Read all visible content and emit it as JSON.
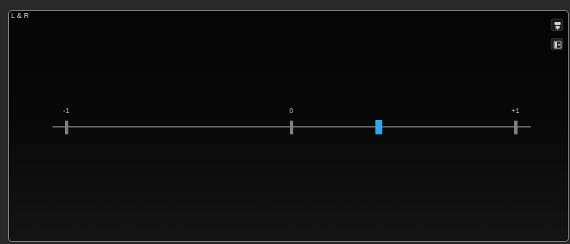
{
  "panel": {
    "title": "L & R"
  },
  "meter": {
    "scale": {
      "min_label": "-1",
      "mid_label": "0",
      "max_label": "+1"
    },
    "value": 0.39,
    "indicator_color": "#2aa8f0"
  },
  "icons": {
    "top_button": "layout-icon",
    "bottom_button": "panel-toggle-icon"
  }
}
